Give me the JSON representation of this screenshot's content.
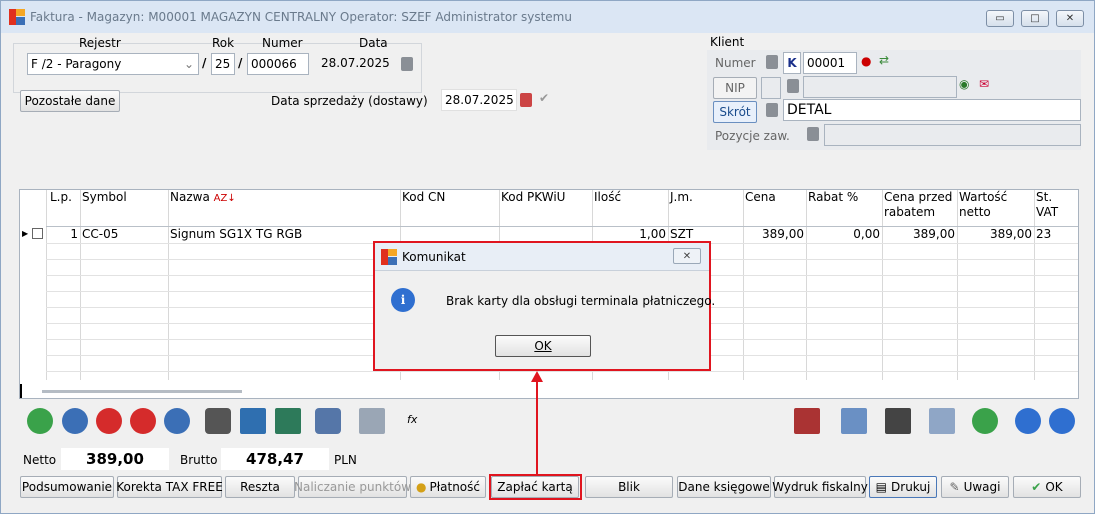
{
  "window": {
    "title": "Faktura - Magazyn: M00001 MAGAZYN CENTRALNY  Operator: SZEF Administrator systemu"
  },
  "doc": {
    "rejestr_label": "Rejestr",
    "rok_label": "Rok",
    "numer_label": "Numer",
    "data_label": "Data",
    "rejestr_value": "F /2  - Paragony",
    "rok_value": "25",
    "numer_value": "000066",
    "data_value": "28.07.2025",
    "sep1": "/",
    "sep2": "/",
    "pozostale_dane": "Pozostałe dane",
    "data_sprzedazy_label": "Data sprzedaży (dostawy)",
    "data_sprzedazy_value": "28.07.2025"
  },
  "klient": {
    "heading": "Klient",
    "numer_label": "Numer",
    "k_badge": "K",
    "numer_value": "00001",
    "nip_label": "NIP",
    "nip_value": "",
    "skrot_label": "Skrót",
    "skrot_value": "DETAL",
    "pozycje_label": "Pozycje zaw.",
    "pozycje_value": ""
  },
  "table": {
    "columns": [
      "L.p.",
      "Symbol",
      "Nazwa",
      "Kod  CN",
      "Kod  PKWiU",
      "Ilość",
      "J.m.",
      "Cena",
      "Rabat %",
      "Cena przed rabatem",
      "Wartość netto",
      "St. VAT"
    ],
    "rows": [
      {
        "lp": "1",
        "symbol": "CC-05",
        "nazwa": "Signum SG1X TG RGB",
        "kod_cn": "",
        "pkwiu": "",
        "ilosc": "1,00",
        "jm": "SZT",
        "cena": "389,00",
        "rabat": "0,00",
        "cena_przed": "389,00",
        "wartosc": "389,00",
        "vat": "23"
      }
    ]
  },
  "totals": {
    "netto_label": "Netto",
    "netto_value": "389,00",
    "brutto_label": "Brutto",
    "brutto_value": "478,47",
    "currency": "PLN"
  },
  "buttons": {
    "podsumowanie": "Podsumowanie",
    "korekta": "Korekta TAX FREE",
    "reszta": "Reszta",
    "naliczanie": "Naliczanie punktów",
    "platnosc": "Płatność",
    "zaplac_karta": "Zapłać kartą",
    "blik": "Blik",
    "dane_ksiegowe": "Dane księgowe",
    "wydruk_fiskalny": "Wydruk fiskalny",
    "drukuj": "Drukuj",
    "uwagi": "Uwagi",
    "ok": "OK"
  },
  "dialog": {
    "title": "Komunikat",
    "message": "Brak karty dla obsługi terminala płatniczego.",
    "ok": "OK"
  },
  "colors": {
    "highlight": "#e0151f",
    "title_bg": "#dbe6f4"
  }
}
